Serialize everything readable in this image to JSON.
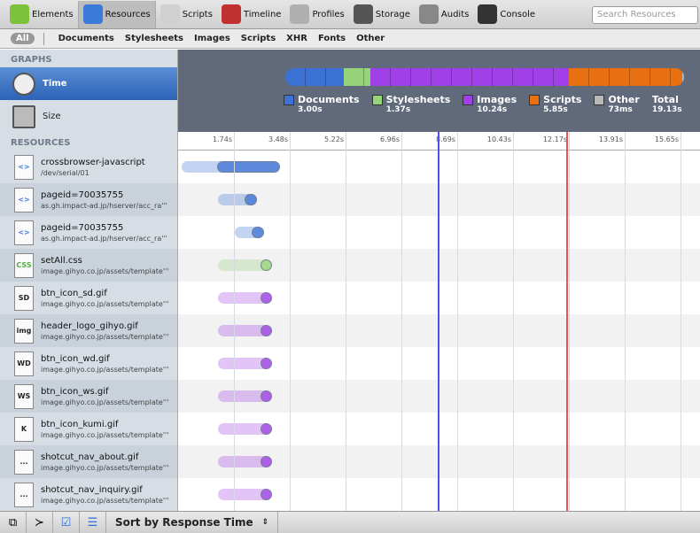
{
  "toolbar": {
    "tabs": [
      {
        "label": "Elements",
        "color": "#7cc23a"
      },
      {
        "label": "Resources",
        "color": "#3a7ad8",
        "selected": true
      },
      {
        "label": "Scripts",
        "color": "#d0d0d0"
      },
      {
        "label": "Timeline",
        "color": "#c03030"
      },
      {
        "label": "Profiles",
        "color": "#b0b0b0"
      },
      {
        "label": "Storage",
        "color": "#555555"
      },
      {
        "label": "Audits",
        "color": "#888888"
      },
      {
        "label": "Console",
        "color": "#333333"
      }
    ],
    "search_placeholder": "Search Resources"
  },
  "filter": {
    "all": "All",
    "items": [
      "Documents",
      "Stylesheets",
      "Images",
      "Scripts",
      "XHR",
      "Fonts",
      "Other"
    ]
  },
  "sidebar": {
    "graphs_header": "GRAPHS",
    "graphs": [
      {
        "label": "Time",
        "selected": true
      },
      {
        "label": "Size"
      }
    ],
    "resources_header": "RESOURCES",
    "resources": [
      {
        "name": "crossbrowser-javascript",
        "sub": "/dev/serial/01",
        "icon": "<>",
        "type": "Documents",
        "start": 0.1,
        "response": 1.22,
        "end": 3.17
      },
      {
        "name": "pageid=70035755",
        "sub": "as.gh.impact-ad.jp/hserver/acc_ra'''",
        "icon": "<>",
        "type": "Documents",
        "start": 1.25,
        "response": 2.07,
        "end": 2.46
      },
      {
        "name": "pageid=70035755",
        "sub": "as.gh.impact-ad.jp/hserver/acc_ra'''",
        "icon": "<>",
        "type": "Documents",
        "start": 1.77,
        "response": 2.29,
        "end": 2.68
      },
      {
        "name": "setAll.css",
        "sub": "image.gihyo.co.jp/assets/template'''",
        "icon": "CSS",
        "type": "Stylesheets",
        "start": 1.25,
        "response": 2.57,
        "end": 2.93
      },
      {
        "name": "btn_icon_sd.gif",
        "sub": "image.gihyo.co.jp/assets/template'''",
        "icon": "SD",
        "type": "Images",
        "start": 1.25,
        "response": 2.57,
        "end": 2.93
      },
      {
        "name": "header_logo_gihyo.gif",
        "sub": "image.gihyo.co.jp/assets/template'''",
        "icon": "img",
        "type": "Images",
        "start": 1.25,
        "response": 2.57,
        "end": 2.93
      },
      {
        "name": "btn_icon_wd.gif",
        "sub": "image.gihyo.co.jp/assets/template'''",
        "icon": "WD",
        "type": "Images",
        "start": 1.25,
        "response": 2.57,
        "end": 2.93
      },
      {
        "name": "btn_icon_ws.gif",
        "sub": "image.gihyo.co.jp/assets/template'''",
        "icon": "WS",
        "type": "Images",
        "start": 1.25,
        "response": 2.57,
        "end": 2.93
      },
      {
        "name": "btn_icon_kumi.gif",
        "sub": "image.gihyo.co.jp/assets/template'''",
        "icon": "K",
        "type": "Images",
        "start": 1.25,
        "response": 2.57,
        "end": 2.93
      },
      {
        "name": "shotcut_nav_about.gif",
        "sub": "image.gihyo.co.jp/assets/template'''",
        "icon": "...",
        "type": "Images",
        "start": 1.25,
        "response": 2.57,
        "end": 2.93
      },
      {
        "name": "shotcut_nav_inquiry.gif",
        "sub": "image.gihyo.co.jp/assets/template'''",
        "icon": "...",
        "type": "Images",
        "start": 1.25,
        "response": 2.57,
        "end": 2.93
      }
    ]
  },
  "summary": {
    "categories": [
      {
        "label": "Documents",
        "value": "3.00s",
        "seconds": 3.0,
        "color": "#3c72d6"
      },
      {
        "label": "Stylesheets",
        "value": "1.37s",
        "seconds": 1.37,
        "color": "#96d47a"
      },
      {
        "label": "Images",
        "value": "10.24s",
        "seconds": 10.24,
        "color": "#a040e8"
      },
      {
        "label": "Scripts",
        "value": "5.85s",
        "seconds": 5.85,
        "color": "#e87010"
      },
      {
        "label": "Other",
        "value": "73ms",
        "seconds": 0.073,
        "color": "#b8b8b8"
      }
    ],
    "total_label": "Total",
    "total_value": "19.13s"
  },
  "ruler": {
    "ticks": [
      "1.74s",
      "3.48s",
      "5.22s",
      "6.96s",
      "8.69s",
      "10.43s",
      "12.17s",
      "13.91s",
      "15.65s"
    ],
    "step": 1.74,
    "dom_content_loaded": 8.1,
    "load": 12.1
  },
  "bottom": {
    "sort_label": "Sort by Response Time"
  }
}
